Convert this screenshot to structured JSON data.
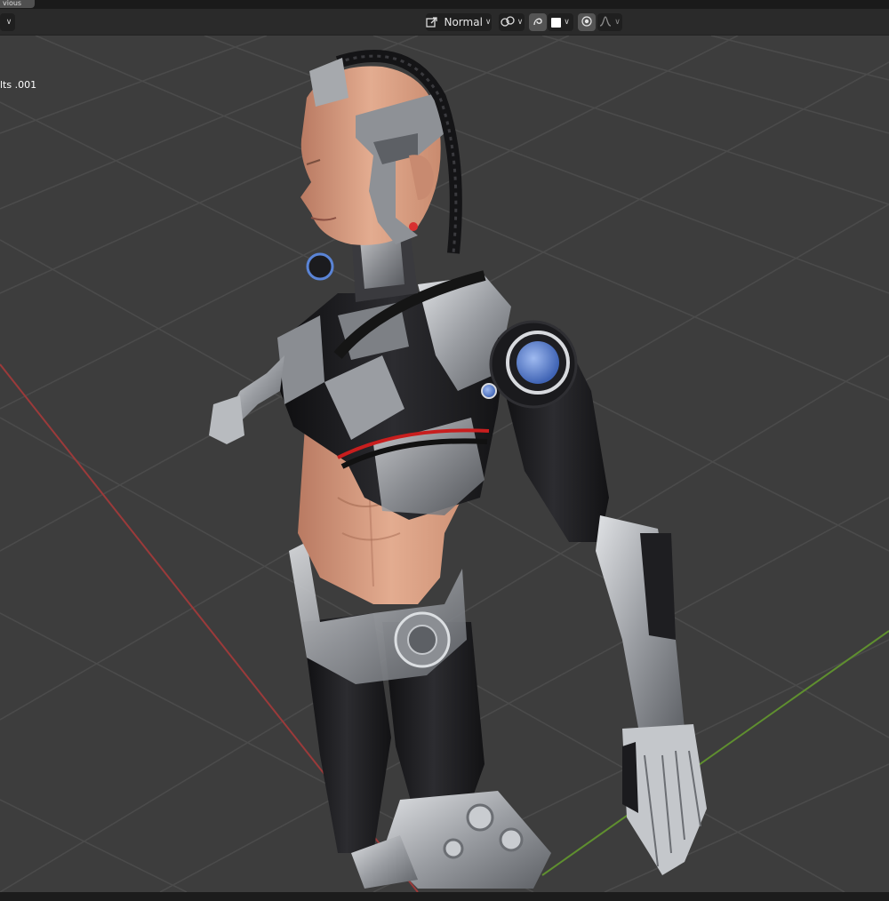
{
  "header": {
    "prev_tab_label": "vious",
    "transform_orientation": "Normal",
    "left_chevron": "∨"
  },
  "viewport": {
    "object_name_fragment": "lts .001",
    "colors": {
      "background": "#3d3d3d",
      "grid": "#4a4a4a",
      "x_axis": "#9b3a3a",
      "y_axis": "#5f8f2f",
      "skin": "#d9a085",
      "metal": "#b9bcc0",
      "dark_metal": "#1c1c1e",
      "accent_blue": "#5a84d6"
    },
    "model": "cyborg-character"
  },
  "icons": [
    "orientation-icon",
    "snap-link-icon",
    "proportional-edit-icon",
    "color-swatch-icon",
    "pivot-dot-icon",
    "falloff-curve-icon"
  ]
}
